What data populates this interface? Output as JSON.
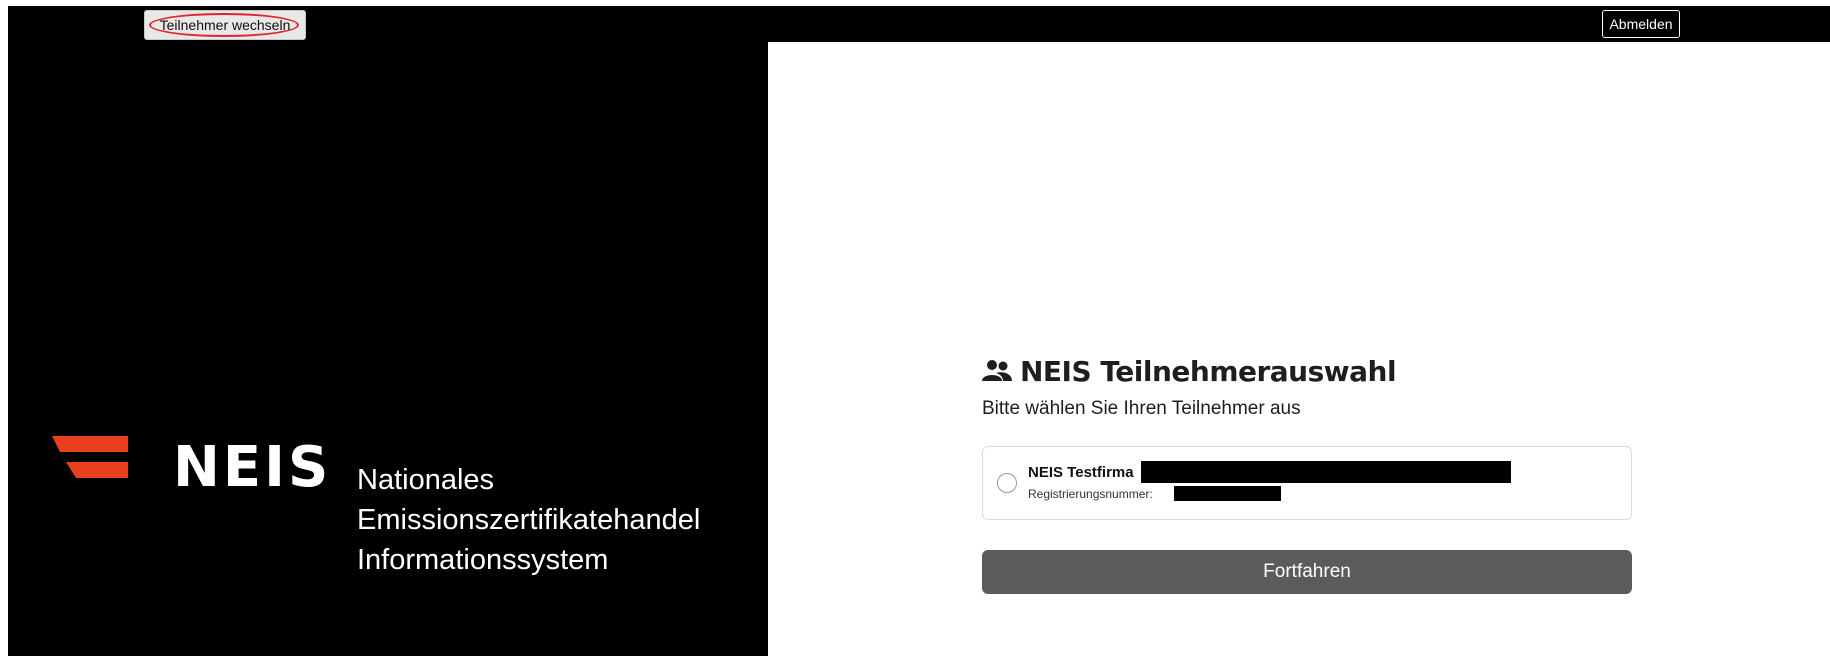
{
  "topbar": {
    "switch_participant_label": "Teilnehmer wechseln",
    "logout_label": "Abmelden"
  },
  "brand": {
    "name": "NEIS",
    "subtitle_line1": "Nationales",
    "subtitle_line2": "Emissionszertifikatehandel",
    "subtitle_line3": "Informationssystem",
    "accent_color": "#e8401e"
  },
  "selection": {
    "icon": "users-icon",
    "title": "NEIS Teilnehmerauswahl",
    "subtitle": "Bitte wählen Sie Ihren Teilnehmer aus",
    "options": [
      {
        "name": "NEIS Testfirma",
        "registration_label": "Registrierungsnummer:",
        "selected": false
      }
    ],
    "continue_label": "Fortfahren",
    "button_color": "#5b5b5b"
  }
}
